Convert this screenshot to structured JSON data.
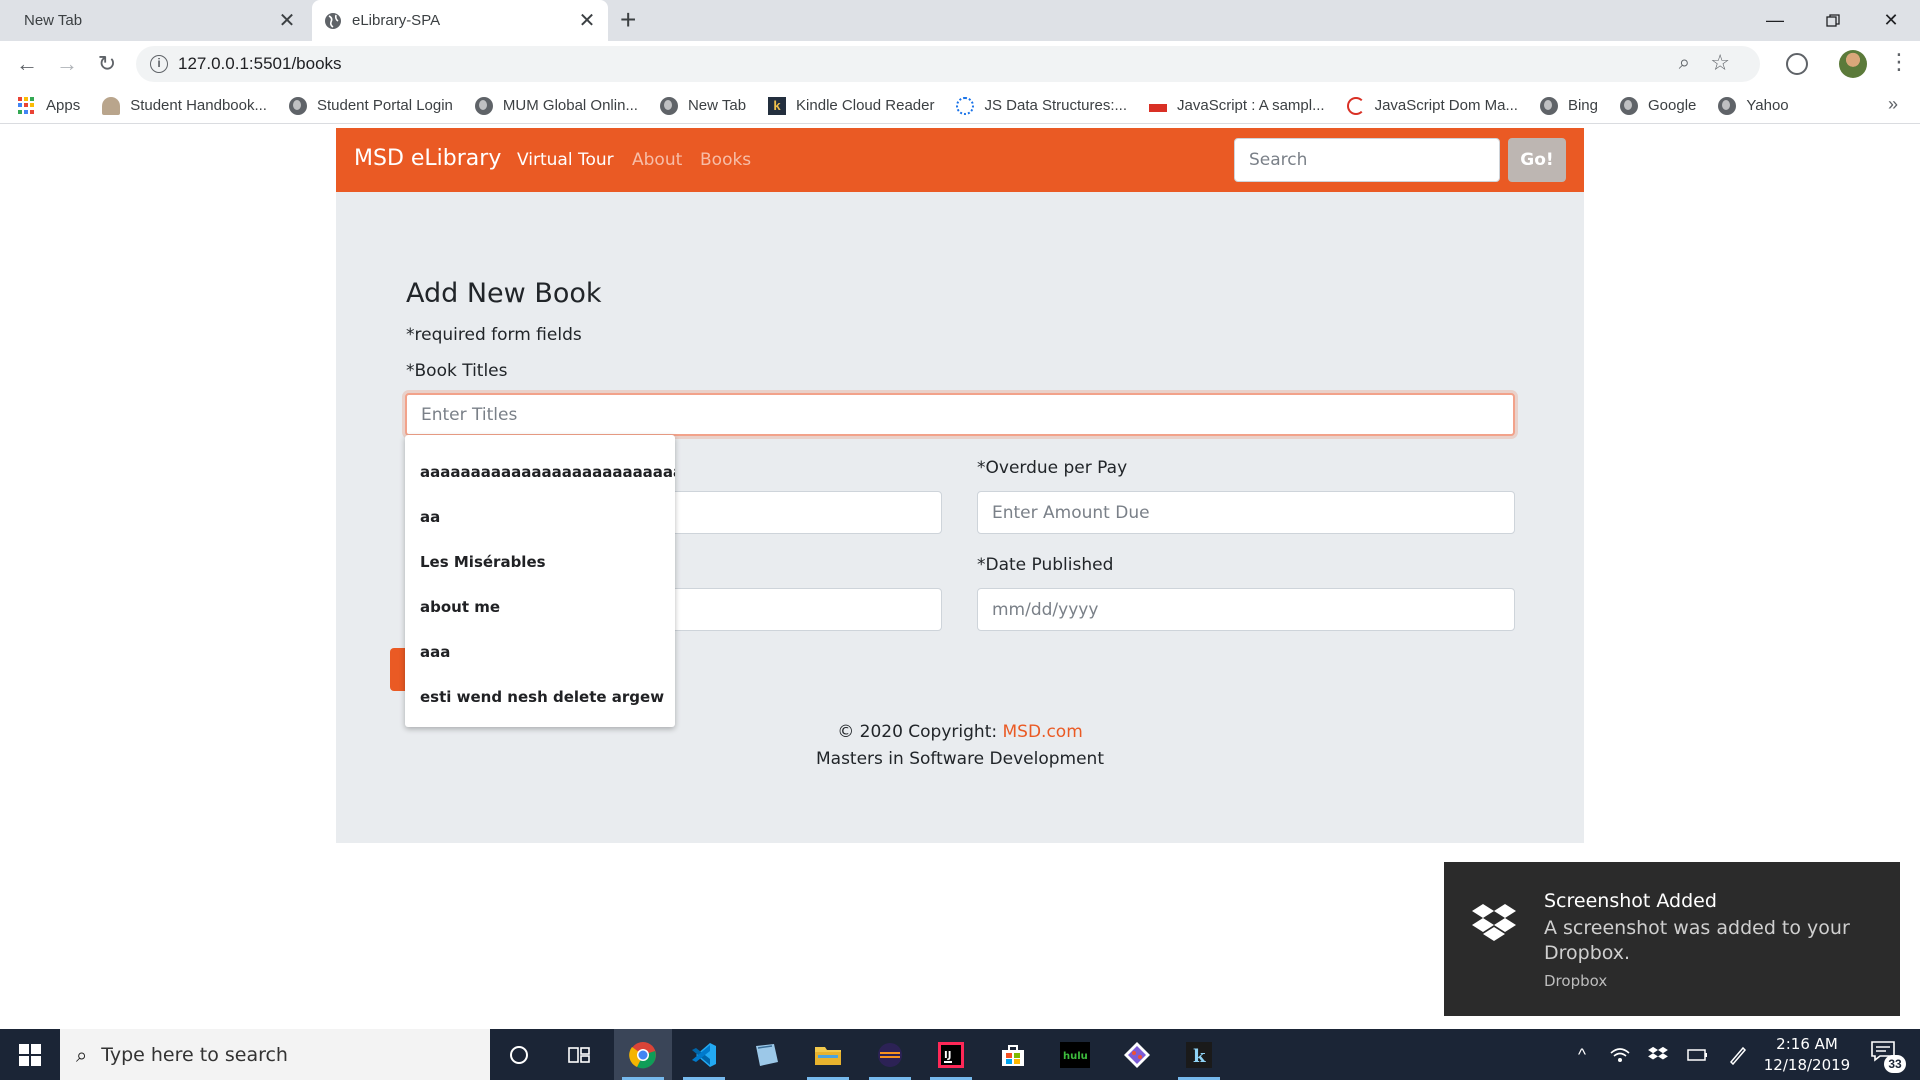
{
  "browser": {
    "tabs": [
      {
        "title": "New Tab",
        "active": false
      },
      {
        "title": "eLibrary-SPA",
        "active": true
      }
    ],
    "url": "127.0.0.1:5501/books",
    "bookmarks": [
      {
        "label": "Apps",
        "icon": "apps-grid-icon"
      },
      {
        "label": "Student Handbook...",
        "icon": "umbrella-icon"
      },
      {
        "label": "Student Portal Login",
        "icon": "globe-icon"
      },
      {
        "label": "MUM Global Onlin...",
        "icon": "globe-icon"
      },
      {
        "label": "New Tab",
        "icon": "globe-icon"
      },
      {
        "label": "Kindle Cloud Reader",
        "icon": "kindle-icon"
      },
      {
        "label": "JS Data Structures:...",
        "icon": "site-icon"
      },
      {
        "label": "JavaScript : A sampl...",
        "icon": "site-icon"
      },
      {
        "label": "JavaScript Dom Ma...",
        "icon": "site-icon"
      },
      {
        "label": "Bing",
        "icon": "globe-icon"
      },
      {
        "label": "Google",
        "icon": "globe-icon"
      },
      {
        "label": "Yahoo",
        "icon": "globe-icon"
      }
    ],
    "bookmarks_overflow": "»"
  },
  "app": {
    "brand": "MSD eLibrary",
    "nav": [
      {
        "label": "Virtual Tour",
        "active": true
      },
      {
        "label": "About",
        "active": false
      },
      {
        "label": "Books",
        "active": false
      }
    ],
    "search_placeholder": "Search",
    "go_label": "Go!",
    "accent_color": "#ea5a24"
  },
  "form": {
    "title": "Add New Book",
    "required_note": "*required form fields",
    "title_label": "*Book Titles",
    "title_placeholder": "Enter Titles",
    "overdue_label": "*Overdue per Pay",
    "overdue_placeholder": "Enter Amount Due",
    "date_label": "*Date Published",
    "date_placeholder": "mm/dd/yyyy"
  },
  "autocomplete": [
    "aaaaaaaaaaaaaaaaaaaaaaaaaaa",
    "aa",
    "Les Misérables",
    "about me",
    "aaa",
    "esti wend nesh delete argew"
  ],
  "footer": {
    "copyright_prefix": "© 2020 Copyright: ",
    "copyright_link": "MSD.com",
    "tagline": "Masters in Software Development"
  },
  "notification": {
    "title": "Screenshot Added",
    "body": "A screenshot was added to your Dropbox.",
    "source": "Dropbox"
  },
  "taskbar": {
    "search_placeholder": "Type here to search",
    "time": "2:16 AM",
    "date": "12/18/2019",
    "notification_count": "33"
  }
}
